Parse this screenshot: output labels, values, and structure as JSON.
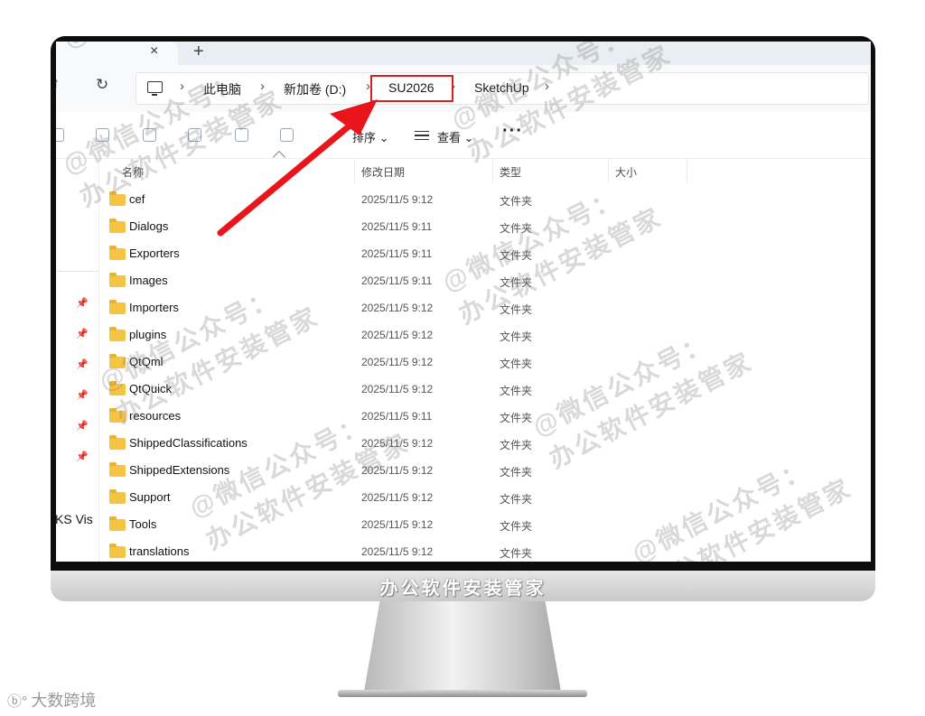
{
  "tabbar": {
    "close_glyph": "×",
    "new_tab_glyph": "+"
  },
  "nav": {
    "up_glyph": "↑",
    "refresh_glyph": "↻"
  },
  "breadcrumb": {
    "icon": "computer-icon",
    "items": [
      "此电脑",
      "新加卷 (D:)",
      "SU2026",
      "SketchUp"
    ],
    "separator": "›"
  },
  "toolbar": {
    "sort_label": "排序",
    "view_label": "查看",
    "more_label": "···",
    "chevron": "⌄"
  },
  "columns": {
    "name": "名称",
    "modified": "修改日期",
    "type": "类型",
    "size": "大小"
  },
  "files": [
    {
      "name": "cef",
      "modified": "2025/11/5 9:12",
      "type": "文件夹"
    },
    {
      "name": "Dialogs",
      "modified": "2025/11/5 9:11",
      "type": "文件夹"
    },
    {
      "name": "Exporters",
      "modified": "2025/11/5 9:11",
      "type": "文件夹"
    },
    {
      "name": "Images",
      "modified": "2025/11/5 9:11",
      "type": "文件夹"
    },
    {
      "name": "Importers",
      "modified": "2025/11/5 9:12",
      "type": "文件夹"
    },
    {
      "name": "plugins",
      "modified": "2025/11/5 9:12",
      "type": "文件夹"
    },
    {
      "name": "QtQml",
      "modified": "2025/11/5 9:12",
      "type": "文件夹"
    },
    {
      "name": "QtQuick",
      "modified": "2025/11/5 9:12",
      "type": "文件夹"
    },
    {
      "name": "resources",
      "modified": "2025/11/5 9:11",
      "type": "文件夹"
    },
    {
      "name": "ShippedClassifications",
      "modified": "2025/11/5 9:12",
      "type": "文件夹"
    },
    {
      "name": "ShippedExtensions",
      "modified": "2025/11/5 9:12",
      "type": "文件夹"
    },
    {
      "name": "Support",
      "modified": "2025/11/5 9:12",
      "type": "文件夹"
    },
    {
      "name": "Tools",
      "modified": "2025/11/5 9:12",
      "type": "文件夹"
    },
    {
      "name": "translations",
      "modified": "2025/11/5 9:12",
      "type": "文件夹"
    }
  ],
  "sidebar": {
    "pin_glyph": "📌",
    "pins": 6,
    "partial_label": "KS Vis"
  },
  "highlight_color": "#d9201e",
  "arrow_color": "#e8161b",
  "watermark": {
    "text_a": "@微信公众号：",
    "text_b": "办公软件安装管家"
  },
  "monitor_label": "办公软件安装管家",
  "corner_logo": "大数跨境"
}
